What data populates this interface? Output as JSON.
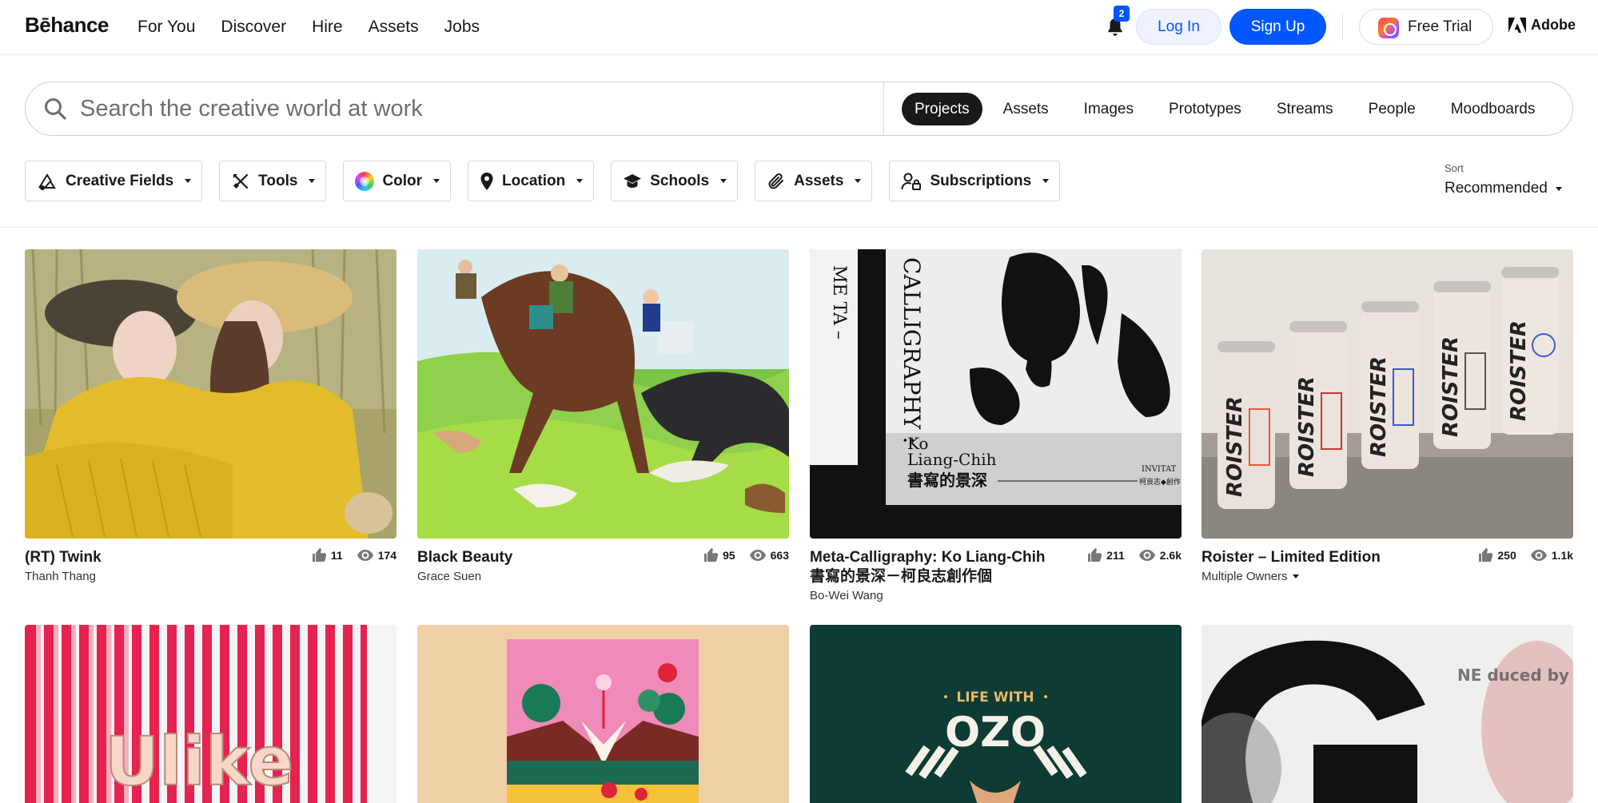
{
  "nav": {
    "logo": "Bēhance",
    "links": [
      "For You",
      "Discover",
      "Hire",
      "Assets",
      "Jobs"
    ],
    "notification_count": "2",
    "login_label": "Log In",
    "signup_label": "Sign Up",
    "trial_label": "Free Trial",
    "adobe_label": "Adobe",
    "accent_color": "#0057ff"
  },
  "search": {
    "placeholder": "Search the creative world at work",
    "tabs": [
      "Projects",
      "Assets",
      "Images",
      "Prototypes",
      "Streams",
      "People",
      "Moodboards"
    ],
    "active_tab": "Projects"
  },
  "filters": {
    "items": [
      {
        "label": "Creative Fields",
        "icon": "creative-fields-icon"
      },
      {
        "label": "Tools",
        "icon": "tools-icon"
      },
      {
        "label": "Color",
        "icon": "color-wheel-icon"
      },
      {
        "label": "Location",
        "icon": "location-pin-icon"
      },
      {
        "label": "Schools",
        "icon": "graduation-cap-icon"
      },
      {
        "label": "Assets",
        "icon": "paperclip-icon"
      },
      {
        "label": "Subscriptions",
        "icon": "person-lock-icon"
      }
    ],
    "sort_label": "Sort",
    "sort_value": "Recommended"
  },
  "projects": [
    {
      "title": "(RT) Twink",
      "owner": "Thanh Thang",
      "likes": "11",
      "views": "174"
    },
    {
      "title": "Black Beauty",
      "owner": "Grace Suen",
      "likes": "95",
      "views": "663"
    },
    {
      "title": "Meta-Calligraphy: Ko Liang-Chih 書寫的景深－柯良志創作個",
      "owner": "Bo-Wei Wang",
      "likes": "211",
      "views": "2.6k"
    },
    {
      "title": "Roister – Limited Edition",
      "owner": "Multiple Owners",
      "likes": "250",
      "views": "1.1k"
    },
    {
      "thumb_text": "Ulike"
    },
    {
      "thumb_text": ""
    },
    {
      "thumb_text_top": "LIFE WITH",
      "thumb_text_main": "OZO"
    },
    {
      "thumb_text_top": "NE duced by Rinhi"
    }
  ],
  "thumb_artwork": {
    "calligraphy_vertical": "CALLIGRAPHY :",
    "calligraphy_meta": "ME TA –",
    "calligraphy_name_1": "Ko",
    "calligraphy_name_2": "Liang-Chih",
    "calligraphy_chinese": "書寫的景深",
    "calligraphy_invite": "INVITAT",
    "calligraphy_artist": "柯良志◆創作",
    "can_brand": "ROISTER",
    "poster_glyph": "G"
  }
}
